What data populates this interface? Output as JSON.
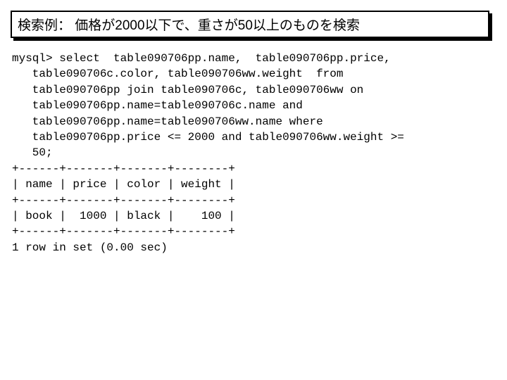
{
  "title": "検索例： 価格が2000以下で、重さが50以上のものを検索",
  "code": "mysql> select  table090706pp.name,  table090706pp.price,\n   table090706c.color, table090706ww.weight  from\n   table090706pp join table090706c, table090706ww on\n   table090706pp.name=table090706c.name and\n   table090706pp.name=table090706ww.name where\n   table090706pp.price <= 2000 and table090706ww.weight >=\n   50;\n+------+-------+-------+--------+\n| name | price | color | weight |\n+------+-------+-------+--------+\n| book |  1000 | black |    100 |\n+------+-------+-------+--------+\n1 row in set (0.00 sec)"
}
